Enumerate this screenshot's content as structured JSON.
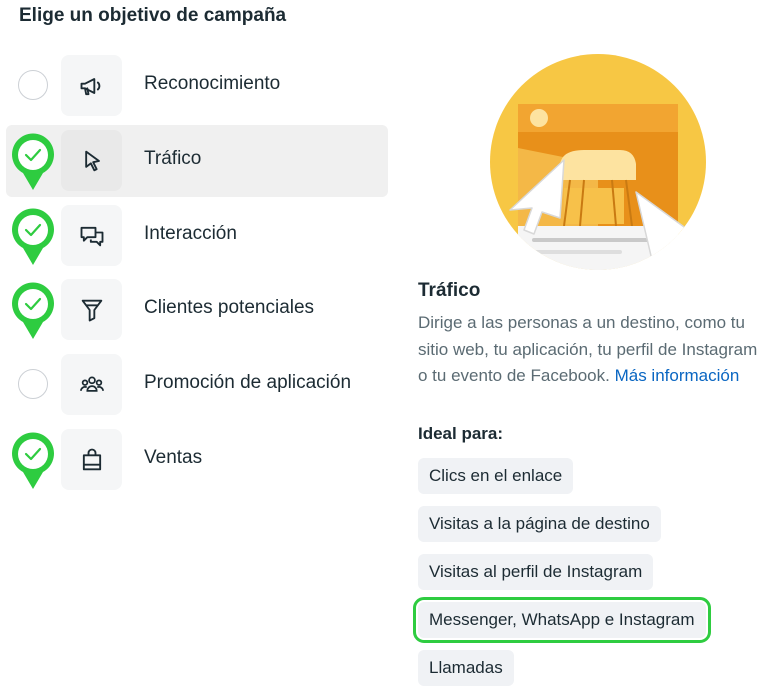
{
  "header": {
    "title": "Elige un objetivo de campaña"
  },
  "objectives": [
    {
      "label": "Reconocimiento",
      "icon": "megaphone-icon",
      "checked": false,
      "selected": false
    },
    {
      "label": "Tráfico",
      "icon": "cursor-icon",
      "checked": true,
      "selected": true
    },
    {
      "label": "Interacción",
      "icon": "chat-bubbles-icon",
      "checked": true,
      "selected": false
    },
    {
      "label": "Clientes potenciales",
      "icon": "filter-icon",
      "checked": true,
      "selected": false
    },
    {
      "label": "Promoción de aplicación",
      "icon": "people-icon",
      "checked": false,
      "selected": false
    },
    {
      "label": "Ventas",
      "icon": "shopping-bag-icon",
      "checked": true,
      "selected": false
    }
  ],
  "detail": {
    "title": "Tráfico",
    "description": "Dirige a las personas a un destino, como tu sitio web, tu aplicación, tu perfil de Instagram o tu evento de Facebook.",
    "more_link": "Más información",
    "ideal_for_label": "Ideal para:",
    "chips": [
      {
        "label": "Clics en el enlace",
        "highlighted": false
      },
      {
        "label": "Visitas a la página de destino",
        "highlighted": false
      },
      {
        "label": "Visitas al perfil de Instagram",
        "highlighted": false
      },
      {
        "label": "Messenger, WhatsApp e Instagram",
        "highlighted": true
      },
      {
        "label": "Llamadas",
        "highlighted": false
      }
    ]
  },
  "colors": {
    "check_green": "#2ecc40",
    "link_blue": "#0a66c2",
    "illustration_yellow": "#f7c744",
    "illustration_orange": "#e8901a"
  }
}
